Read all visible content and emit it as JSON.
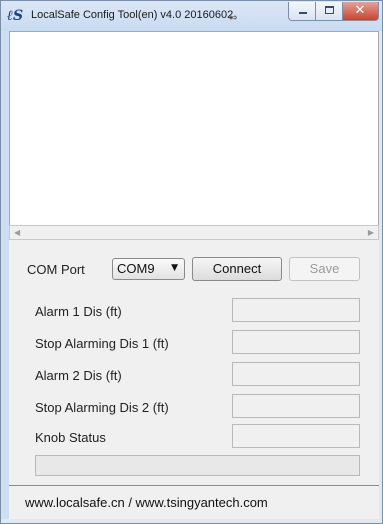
{
  "window": {
    "title": "LocalSafe Config Tool(en) v4.0 20160602",
    "app_icon": "localsafe-logo-icon",
    "overlay_glyph": "⇔",
    "controls": {
      "minimize": "minimize-icon",
      "maximize": "maximize-icon",
      "close_glyph": "✕"
    }
  },
  "log_area": {
    "text": ""
  },
  "connection": {
    "com_port_label": "COM Port",
    "com_port_value": "COM9",
    "connect_label": "Connect",
    "save_label": "Save"
  },
  "fields": [
    {
      "label": "Alarm 1 Dis (ft)",
      "value": ""
    },
    {
      "label": "Stop Alarming Dis 1 (ft)",
      "value": ""
    },
    {
      "label": "Alarm 2 Dis (ft)",
      "value": ""
    },
    {
      "label": "Stop Alarming Dis 2 (ft)",
      "value": ""
    },
    {
      "label": "Knob Status",
      "value": ""
    }
  ],
  "progress": {
    "value": 0
  },
  "footer": {
    "text": "www.localsafe.cn / www.tsingyantech.com"
  },
  "colors": {
    "window_frame": "#dfe9f5",
    "close_button": "#c9442f",
    "client_bg": "#f0f0f0"
  }
}
